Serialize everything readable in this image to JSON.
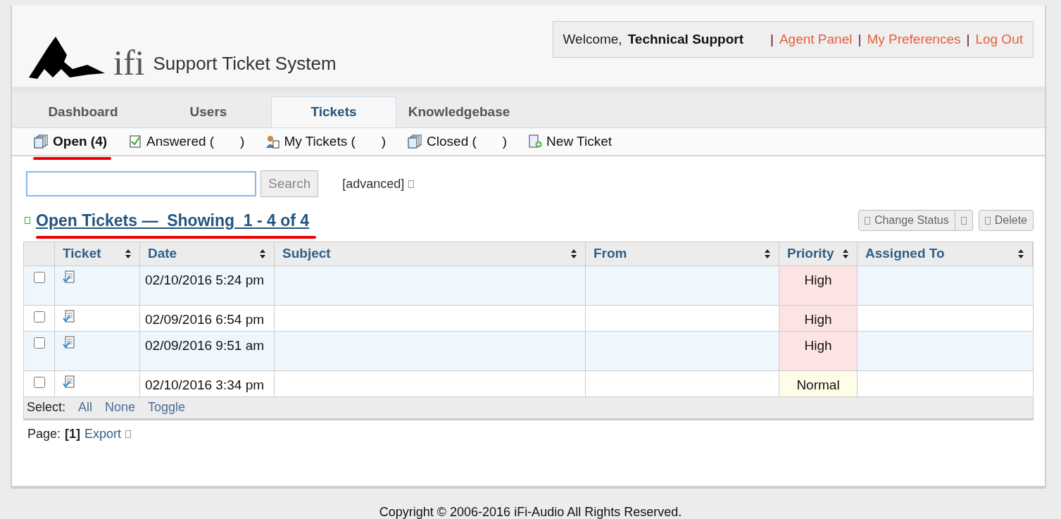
{
  "header": {
    "logo_text": "ifi",
    "title": "Support Ticket System",
    "welcome": "Welcome,",
    "user": "Technical Support",
    "separator": "|",
    "links": [
      "Agent Panel",
      "My Preferences",
      "Log Out"
    ]
  },
  "tabs": [
    {
      "label": "Dashboard",
      "selected": false
    },
    {
      "label": "Users",
      "selected": false
    },
    {
      "label": "Tickets",
      "selected": true
    },
    {
      "label": "Knowledgebase",
      "selected": false
    }
  ],
  "subnav": [
    {
      "kind": "stack",
      "label": "Open (4)",
      "selected": true,
      "underlined": true
    },
    {
      "kind": "check",
      "label": "Answered (",
      "suffix": ")",
      "selected": false
    },
    {
      "kind": "person",
      "label": "My Tickets (",
      "suffix": ")",
      "selected": false
    },
    {
      "kind": "stack",
      "label": "Closed (",
      "suffix": ")",
      "selected": false
    },
    {
      "kind": "new",
      "label": "New Ticket",
      "selected": false
    }
  ],
  "search": {
    "button": "Search",
    "advanced": "[advanced]"
  },
  "list_title": {
    "text": "Open Tickets —  Showing  1 - 4 of 4",
    "underlined": true
  },
  "actions": [
    "Change Status",
    "Delete"
  ],
  "table": {
    "columns": [
      "Ticket",
      "Date",
      "Subject",
      "From",
      "Priority",
      "Assigned To"
    ],
    "rows": [
      {
        "checked": false,
        "highlighted": true,
        "date": "02/10/2016 5:24 pm",
        "priority": "High",
        "color": "#fde4e4"
      },
      {
        "checked": false,
        "highlighted": false,
        "date": "02/09/2016 6:54 pm",
        "priority": "High",
        "color": "#fde4e4"
      },
      {
        "checked": false,
        "highlighted": true,
        "date": "02/09/2016 9:51 am",
        "priority": "High",
        "color": "#fde4e4"
      },
      {
        "checked": false,
        "highlighted": false,
        "date": "02/10/2016 3:34 pm",
        "priority": "Normal",
        "color": "#fefde8"
      }
    ]
  },
  "select": {
    "label": "Select:",
    "options": [
      "All",
      "None",
      "Toggle"
    ]
  },
  "pager": {
    "label": "Page:",
    "current": "[1]",
    "export": "Export"
  },
  "footer": "Copyright © 2006-2016 iFi-Audio All Rights Reserved."
}
